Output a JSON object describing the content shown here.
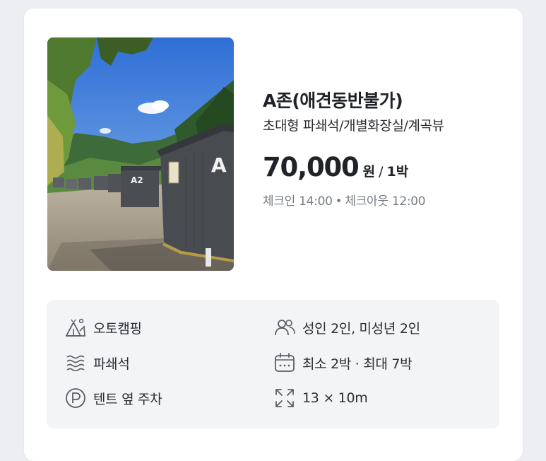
{
  "product": {
    "title": "A존(애견동반불가)",
    "subtitle": "초대형 파쇄석/개별화장실/계곡뷰",
    "price": "70,000",
    "price_unit": "원",
    "price_separator": "/",
    "price_per": "1박",
    "checkin": "체크인 14:00",
    "dot": "•",
    "checkout": "체크아웃 12:00"
  },
  "photo": {
    "cabin_labels": [
      "A",
      "A2"
    ]
  },
  "features": {
    "camping_type": {
      "icon": "tent-icon",
      "label": "오토캠핑"
    },
    "capacity": {
      "icon": "people-icon",
      "label": "성인 2인, 미성년 2인"
    },
    "ground": {
      "icon": "gravel-icon",
      "label": "파쇄석"
    },
    "stay": {
      "icon": "calendar-icon",
      "label": "최소 2박 · 최대 7박"
    },
    "parking": {
      "icon": "parking-icon",
      "label": "텐트 옆 주차"
    },
    "size": {
      "icon": "expand-icon",
      "label": "13 × 10m"
    }
  },
  "colors": {
    "background": "#eceef1",
    "card": "#ffffff",
    "feature_panel": "#f3f4f6",
    "text_primary": "#1f2227",
    "text_muted": "#777c84",
    "icon": "#5a5f66"
  }
}
